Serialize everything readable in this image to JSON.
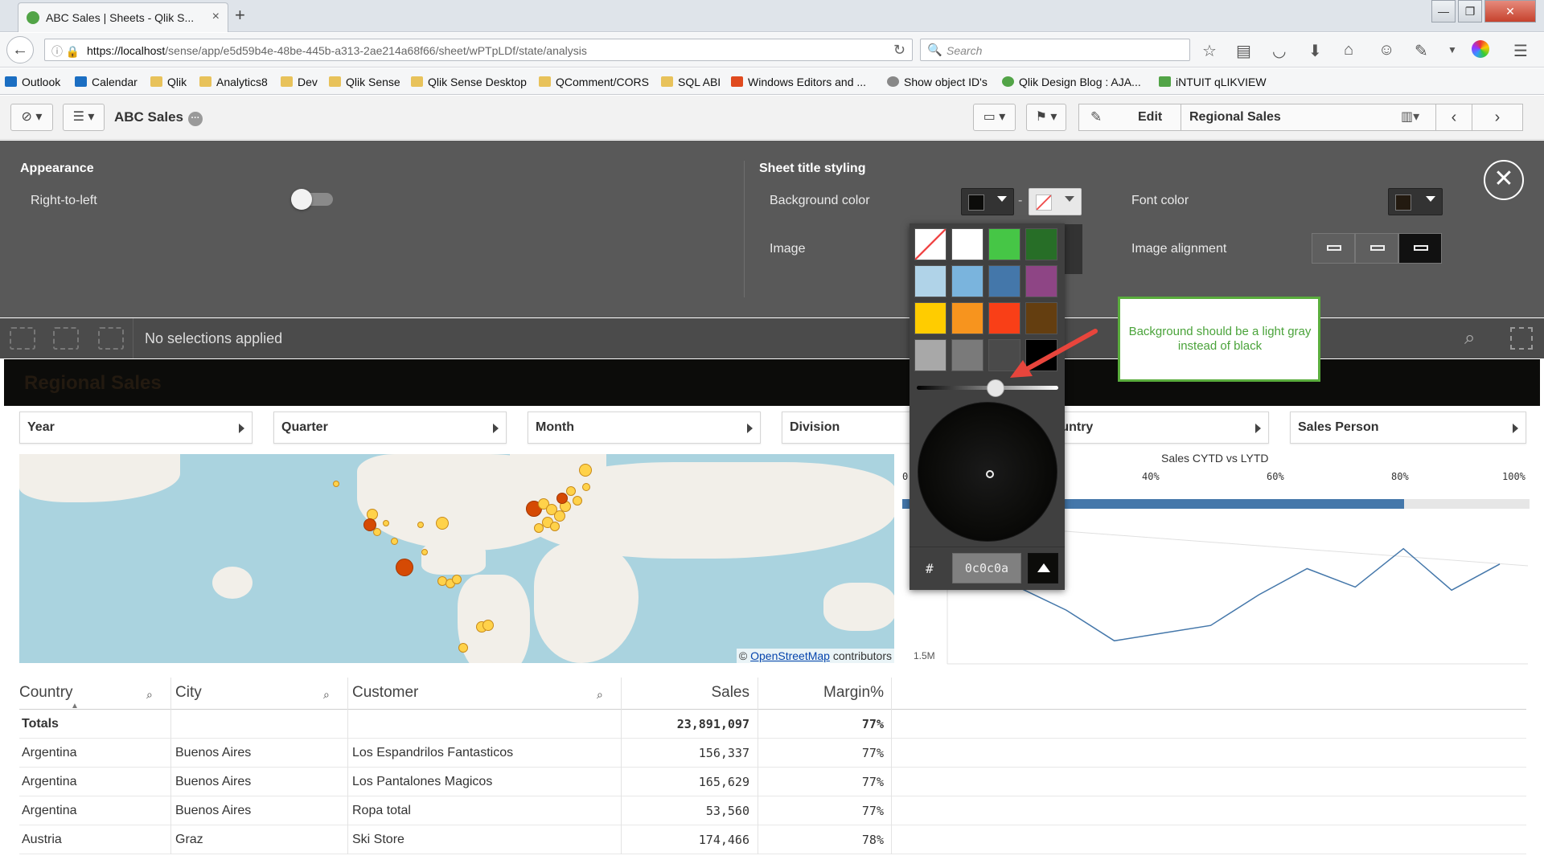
{
  "browser": {
    "tab_title": "ABC Sales | Sheets - Qlik S...",
    "tab_close": "×",
    "new_tab": "+",
    "url_host": "https://localhost",
    "url_path": "/sense/app/e5d59b4e-48be-445b-a313-2ae214a68f66/sheet/wPTpLDf/state/analysis",
    "search_placeholder": "Search",
    "window_buttons": [
      "—",
      "❐",
      "✕"
    ],
    "bookmarks": [
      {
        "label": "Outlook",
        "color": "#1b6ec2"
      },
      {
        "label": "Calendar",
        "color": "#1b6ec2"
      },
      {
        "label": "Qlik",
        "color": "#e8c25a"
      },
      {
        "label": "Analytics8",
        "color": "#e8c25a"
      },
      {
        "label": "Dev",
        "color": "#e8c25a"
      },
      {
        "label": "Qlik Sense",
        "color": "#e8c25a"
      },
      {
        "label": "Qlik Sense Desktop",
        "color": "#e8c25a"
      },
      {
        "label": "QComment/CORS",
        "color": "#e8c25a"
      },
      {
        "label": "SQL ABI",
        "color": "#e8c25a"
      },
      {
        "label": "Windows Editors and ...",
        "color": "#e04a1e"
      },
      {
        "label": "Show object ID's",
        "color": "#888888"
      },
      {
        "label": "Qlik Design Blog : AJA...",
        "color": "#52a447"
      },
      {
        "label": "iNTUIT qLIKVIEW",
        "color": "#52a447"
      }
    ]
  },
  "toolbar": {
    "app_title": "ABC Sales",
    "app_menu_dots": "···",
    "edit_label": "Edit",
    "sheet_name": "Regional Sales"
  },
  "panel": {
    "appearance_heading": "Appearance",
    "rtl_label": "Right-to-left",
    "sheet_title_heading": "Sheet title styling",
    "bg_color_label": "Background color",
    "bg_dash": "-",
    "image_label": "Image",
    "font_color_label": "Font color",
    "image_alignment_label": "Image alignment",
    "close_symbol": "✕"
  },
  "selections": {
    "text": "No selections applied"
  },
  "sheet": {
    "title": "Regional Sales",
    "filters": [
      "Year",
      "Quarter",
      "Month",
      "Division",
      "Country",
      "Sales Person"
    ]
  },
  "map": {
    "attribution_prefix": "©",
    "attribution_link": "OpenStreetMap",
    "attribution_suffix": "contributors"
  },
  "chart_data": [
    {
      "type": "bar",
      "title": "Sales CYTD vs LYTD",
      "x_ticks": [
        "0",
        "40%",
        "60%",
        "80%",
        "100%"
      ],
      "values": [
        0.8
      ],
      "xlim": [
        0,
        1
      ]
    },
    {
      "type": "line",
      "y_ticks": [
        "1.5M"
      ],
      "x": [
        1,
        2,
        3,
        4,
        5,
        6,
        7,
        8,
        9,
        10,
        11,
        12
      ],
      "values": [
        2.0,
        2.0,
        1.85,
        1.65,
        1.7,
        1.75,
        1.95,
        2.12,
        2.0,
        2.25,
        1.98,
        2.15
      ]
    }
  ],
  "table": {
    "headers": [
      "Country",
      "City",
      "Customer",
      "Sales",
      "Margin%"
    ],
    "totals": {
      "label": "Totals",
      "sales": "23,891,097",
      "margin": "77%"
    },
    "rows": [
      {
        "country": "Argentina",
        "city": "Buenos Aires",
        "customer": "Los Espandrilos Fantasticos",
        "sales": "156,337",
        "margin": "77%"
      },
      {
        "country": "Argentina",
        "city": "Buenos Aires",
        "customer": "Los Pantalones Magicos",
        "sales": "165,629",
        "margin": "77%"
      },
      {
        "country": "Argentina",
        "city": "Buenos Aires",
        "customer": "Ropa total",
        "sales": "53,560",
        "margin": "77%"
      },
      {
        "country": "Austria",
        "city": "Graz",
        "customer": "Ski Store",
        "sales": "174,466",
        "margin": "78%"
      }
    ]
  },
  "picker": {
    "swatches": [
      "transparent",
      "#ffffff",
      "#46c646",
      "#276e27",
      "#b0d3e8",
      "#7ab4dd",
      "#4477aa",
      "#8e4585",
      "#ffcc00",
      "#f7941e",
      "#f93f17",
      "#643e10",
      "#a8a8a8",
      "#7a7a7a",
      "#4a4a4a",
      "#000000"
    ],
    "hash": "#",
    "hex_value": "0c0c0a"
  },
  "annotation": {
    "text": "Background should be a light gray instead of black"
  },
  "colors": {
    "sheet_title_bg": "#0c0c0a",
    "panel_bg": "#595959",
    "note_border": "#5aad3d",
    "arrow": "#e8453c"
  }
}
